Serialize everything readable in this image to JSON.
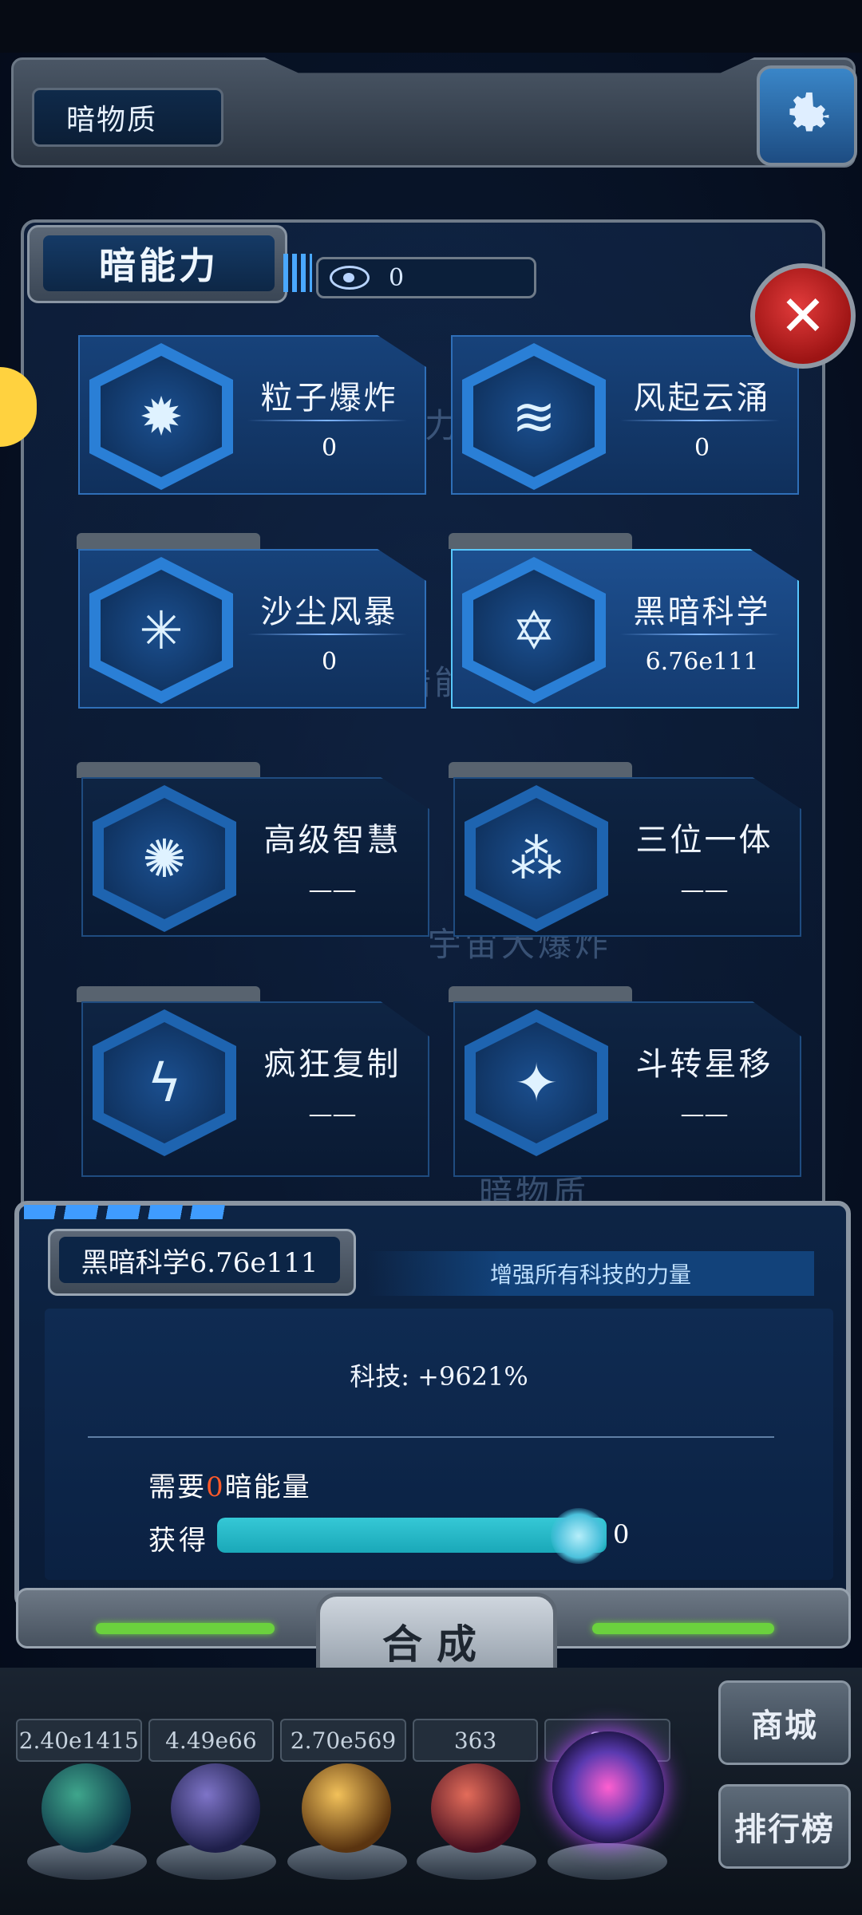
{
  "header": {
    "title": "暗物质"
  },
  "panel": {
    "title": "暗能力",
    "points": "0",
    "close_symbol": "✕"
  },
  "skills": [
    {
      "name": "粒子爆炸",
      "value": "0",
      "icon": "particle-explosion-icon",
      "glyph": "✹"
    },
    {
      "name": "风起云涌",
      "value": "0",
      "icon": "tornado-icon",
      "glyph": "≋"
    },
    {
      "name": "沙尘风暴",
      "value": "0",
      "icon": "sandstorm-icon",
      "glyph": "✳"
    },
    {
      "name": "黑暗科学",
      "value": "6.76e111",
      "icon": "dark-science-icon",
      "glyph": "✡"
    },
    {
      "name": "高级智慧",
      "value": "——",
      "icon": "brain-icon",
      "glyph": "✺"
    },
    {
      "name": "三位一体",
      "value": "——",
      "icon": "trinity-icon",
      "glyph": "⁂"
    },
    {
      "name": "疯狂复制",
      "value": "——",
      "icon": "lightning-icon",
      "glyph": "ϟ"
    },
    {
      "name": "斗转星移",
      "value": "——",
      "icon": "swirl-icon",
      "glyph": "✦"
    }
  ],
  "background_labels": [
    "暗能力",
    "暗能",
    "宇宙大爆炸",
    "暗物质"
  ],
  "detail": {
    "title": "黑暗科学6.76e111",
    "description": "增强所有科技的力量",
    "tech_line": "科技: +9621%",
    "need_prefix": "需要",
    "need_amount": "0",
    "need_suffix": "暗能量",
    "gain_label": "获得",
    "gain_value": "0",
    "gain_progress": 1.0
  },
  "synthesize_label": "合成",
  "resources": [
    "2.40e1415",
    "4.49e66",
    "2.70e569",
    "363",
    "2..."
  ],
  "side_buttons": {
    "shop": "商城",
    "ranking": "排行榜"
  },
  "colors": {
    "accent": "#36c2ff",
    "need_highlight": "#ff5a2a",
    "progress": "#35c8d6",
    "close": "#d42a2a"
  }
}
